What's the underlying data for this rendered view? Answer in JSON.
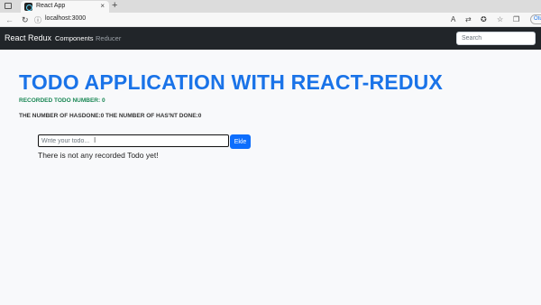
{
  "browser": {
    "tab_title": "React App",
    "tab_close": "×",
    "new_tab": "+",
    "url": "localhost:3000",
    "profile_label": "Otu"
  },
  "navbar": {
    "brand": "React Redux",
    "links": [
      {
        "label": "Components",
        "active": true
      },
      {
        "label": "Reducer",
        "active": false
      }
    ],
    "search_placeholder": "Search"
  },
  "main": {
    "title": "TODO APPLICATION WITH REACT-REDUX",
    "recorded_text": "RECORDED TODO NUMBER: 0",
    "counts_text": "THE NUMBER OF HASDONE:0 THE NUMBER OF HAS'NT DONE:0",
    "input_placeholder": "Write your todo...",
    "add_button": "Ekle",
    "empty_message": "There is not any recorded Todo yet!"
  },
  "colors": {
    "accent": "#1a73e8",
    "success": "#198754",
    "navbar_bg": "#212529",
    "button": "#0d6efd"
  }
}
